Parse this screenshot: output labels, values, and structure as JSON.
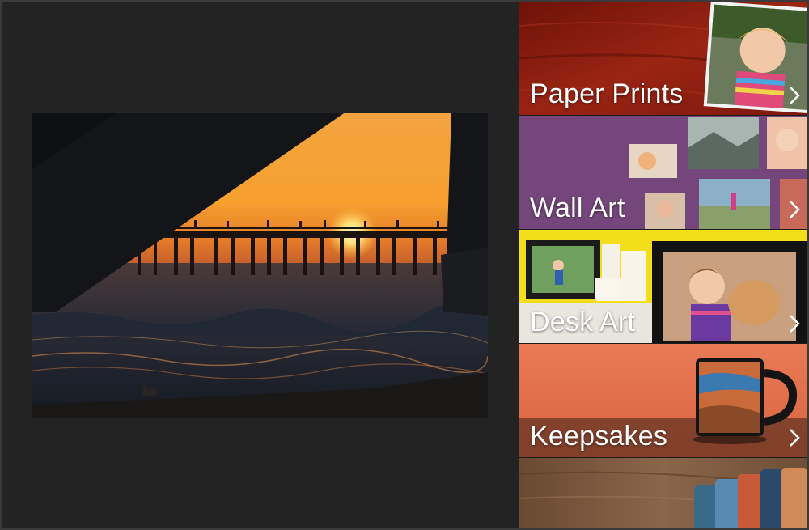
{
  "preview": {
    "image_description_icon": "photo-sunset-pier"
  },
  "products": {
    "items": [
      {
        "label": "Paper Prints",
        "icon": "chevron-right-icon"
      },
      {
        "label": "Wall Art",
        "icon": "chevron-right-icon"
      },
      {
        "label": "Desk Art",
        "icon": "chevron-right-icon"
      },
      {
        "label": "Keepsakes",
        "icon": "chevron-right-icon"
      },
      {
        "label": "",
        "icon": "chevron-right-icon"
      }
    ]
  },
  "colors": {
    "pane_bg": "#232323",
    "paper_prints_bg": "#8e1d12",
    "wall_art_bg": "#6e3f75",
    "desk_art_bg": "#f2df1a",
    "keepsakes_bg": "#e47b57",
    "wood_bg": "#7b5a40"
  }
}
